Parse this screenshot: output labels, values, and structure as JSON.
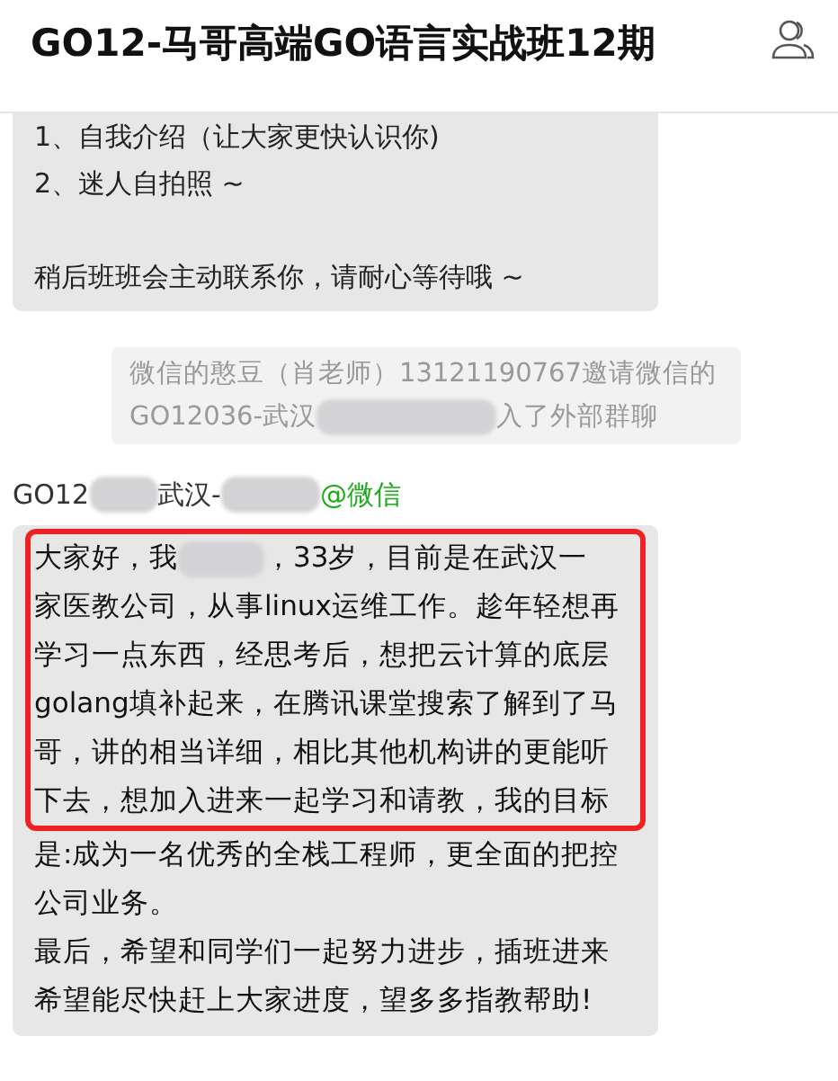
{
  "header": {
    "title": "GO12-马哥高端GO语言实战班12期"
  },
  "messages": [
    {
      "kind": "bubble",
      "paragraphs": [
        [
          "1、自我介绍（让大家更快认识你)",
          "2、迷人自拍照 ~"
        ],
        [
          "稍后班班会主动联系你，请耐心等待哦 ~"
        ]
      ]
    },
    {
      "kind": "system",
      "lines": [
        [
          "微信的憨豆（肖老师）13121190767邀请微信的"
        ],
        [
          "GO12036-武汉",
          "入了外部群聊"
        ]
      ]
    },
    {
      "kind": "sender",
      "parts": [
        "GO12",
        "武汉-"
      ],
      "source": "@微信"
    },
    {
      "kind": "highlighted",
      "highlight": [
        [
          "大家好，我",
          "，33岁，目前是在武汉一"
        ],
        [
          "家医教公司，从事linux运维工作。趁年轻想再"
        ],
        [
          "学习一点东西，经思考后，想把云计算的底层"
        ],
        [
          "golang填补起来，在腾讯课堂搜索了解到了马"
        ],
        [
          "哥，讲的相当详细，相比其他机构讲的更能听"
        ],
        [
          "下去，想加入进来一起学习和请教，我的目标"
        ]
      ],
      "rest": [
        "是:成为一名优秀的全栈工程师，更全面的把控",
        "公司业务。",
        "最后，希望和同学们一起努力进步，插班进来",
        "希望能尽快赶上大家进度，望多多指教帮助!"
      ]
    }
  ]
}
